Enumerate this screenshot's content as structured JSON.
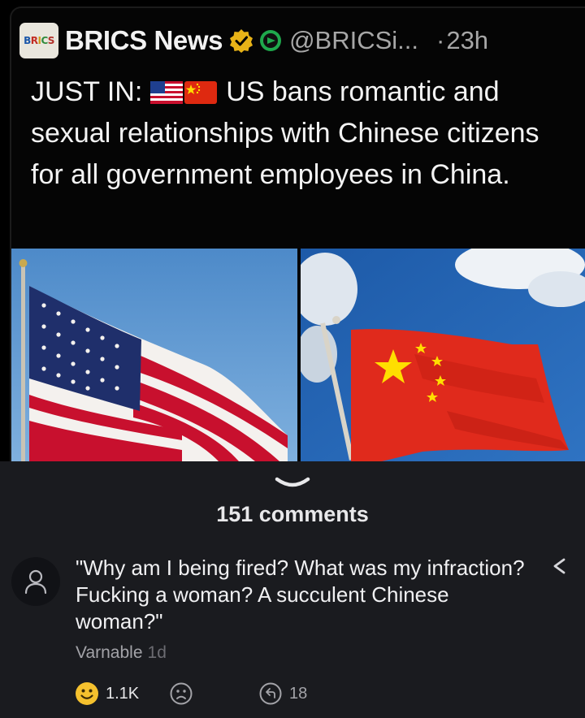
{
  "tweet": {
    "logo_text": "BRICS",
    "account_name": "BRICS News",
    "handle": "@BRICSi...",
    "separator": "·",
    "time": "23h",
    "text_prefix": "JUST IN:",
    "text_body": "US bans romantic and sexual relationships with Chinese citizens for all government employees in China.",
    "emojis": [
      "us-flag-icon",
      "china-flag-icon"
    ]
  },
  "comments_section": {
    "count_label": "151 comments",
    "comment": {
      "text": "\"Why am I being fired? What was my infraction? Fucking a woman? A succulent Chinese woman?\"",
      "author": "Varnable",
      "age": "1d",
      "likes": "1.1K",
      "replies": "18"
    }
  },
  "colors": {
    "page_background": "#1a1b1f",
    "tweet_background": "#000000",
    "verified_gold": "#e8b317",
    "like_emoji": "#f5c12e"
  }
}
